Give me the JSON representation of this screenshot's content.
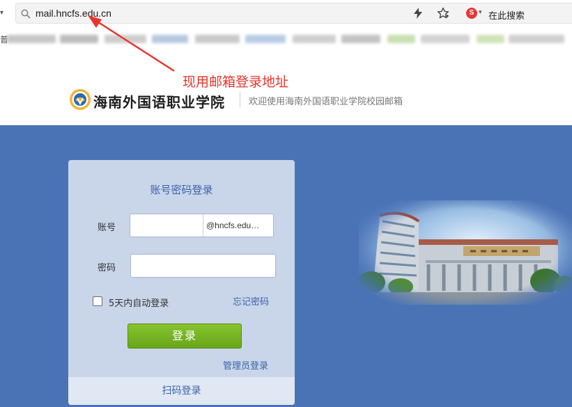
{
  "browser": {
    "url": "mail.hncfs.edu.cn",
    "search_engine_label": "在此搜索",
    "search_engine_badge": "S",
    "bookmark_edge_char": "普"
  },
  "annotation": {
    "text": "现用邮箱登录地址",
    "color": "#e8342b"
  },
  "header": {
    "school_name": "海南外国语职业学院",
    "welcome": "欢迎使用海南外国语职业学院校园邮箱"
  },
  "login": {
    "title": "账号密码登录",
    "account_label": "账号",
    "account_value": "",
    "account_domain": "@hncfs.edu…",
    "password_label": "密码",
    "password_value": "",
    "remember_label": "5天内自动登录",
    "remember_checked": false,
    "forgot_link": "忘记密码",
    "submit_label": "登录",
    "admin_link": "管理员登录",
    "qr_login": "扫码登录"
  },
  "colors": {
    "band": "#4a73b6",
    "card": "#c9d5e9",
    "link": "#3a64a8",
    "button": "#6fac1f"
  },
  "icons": {
    "address_search": "search-icon",
    "bolt": "bolt-icon",
    "star": "star-icon",
    "engine": "search-engine-icon",
    "logo": "school-emblem-icon"
  }
}
